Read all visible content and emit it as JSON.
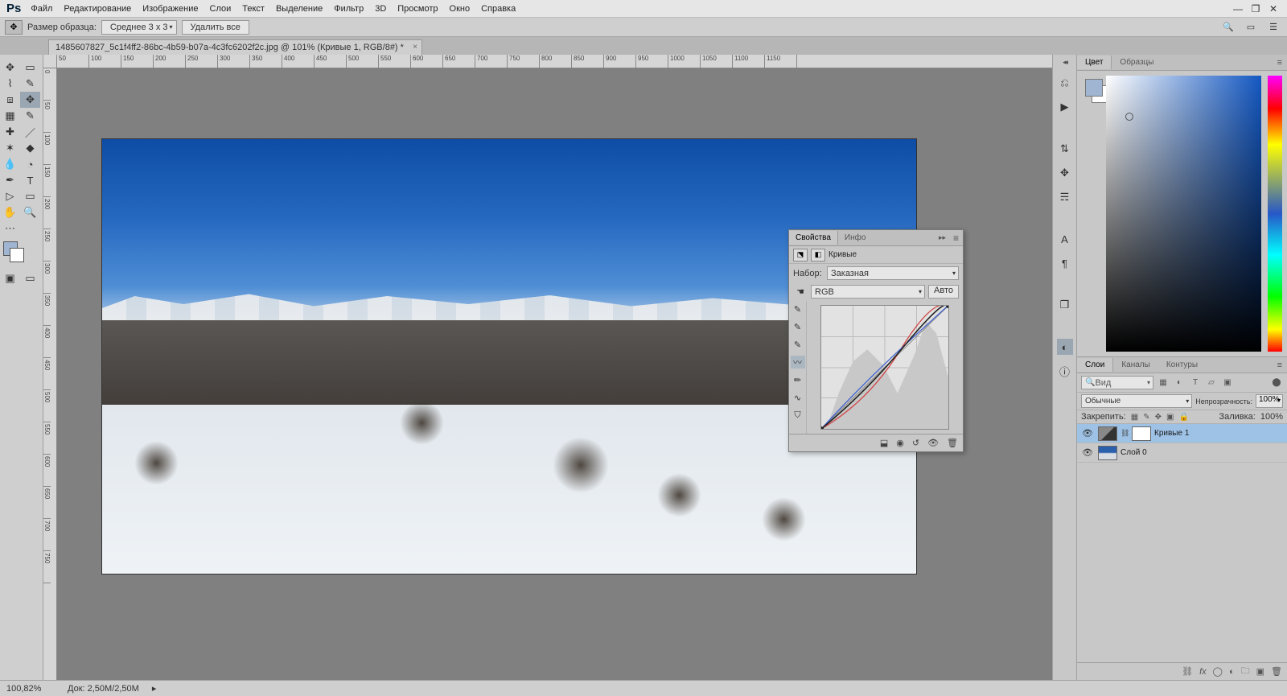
{
  "menu": {
    "items": [
      "Файл",
      "Редактирование",
      "Изображение",
      "Слои",
      "Текст",
      "Выделение",
      "Фильтр",
      "3D",
      "Просмотр",
      "Окно",
      "Справка"
    ]
  },
  "options": {
    "sample_lbl": "Размер образца:",
    "sample_val": "Среднее 3 x 3",
    "clear": "Удалить все"
  },
  "tab": {
    "title": "1485607827_5c1f4ff2-86bc-4b59-b07a-4c3fc6202f2c.jpg @ 101% (Кривые 1, RGB/8#) *"
  },
  "ruler_h": [
    "50",
    "100",
    "150",
    "200",
    "250",
    "300",
    "350",
    "400",
    "450",
    "500",
    "550",
    "600",
    "650",
    "700",
    "750",
    "800",
    "850",
    "900",
    "950",
    "1000",
    "1050",
    "1100",
    "1150"
  ],
  "ruler_v": [
    "0",
    "50",
    "100",
    "150",
    "200",
    "250",
    "300",
    "350",
    "400",
    "450",
    "500",
    "550",
    "600",
    "650",
    "700",
    "750"
  ],
  "right_tabs_color": {
    "tab1": "Цвет",
    "tab2": "Образцы"
  },
  "right_tabs_layers": {
    "tab1": "Слои",
    "tab2": "Каналы",
    "tab3": "Контуры"
  },
  "layers": {
    "kind": "Вид",
    "blend": "Обычные",
    "opacity_lbl": "Непрозрачность:",
    "opacity": "100%",
    "lock_lbl": "Закрепить:",
    "fill_lbl": "Заливка:",
    "fill": "100%",
    "l0": "Кривые 1",
    "l1": "Слой 0"
  },
  "props": {
    "tab1": "Свойства",
    "tab2": "Инфо",
    "title": "Кривые",
    "preset_lbl": "Набор:",
    "preset_val": "Заказная",
    "channel_val": "RGB",
    "auto": "Авто"
  },
  "status": {
    "zoom": "100,82%",
    "doc": "Док: 2,50M/2,50M"
  }
}
